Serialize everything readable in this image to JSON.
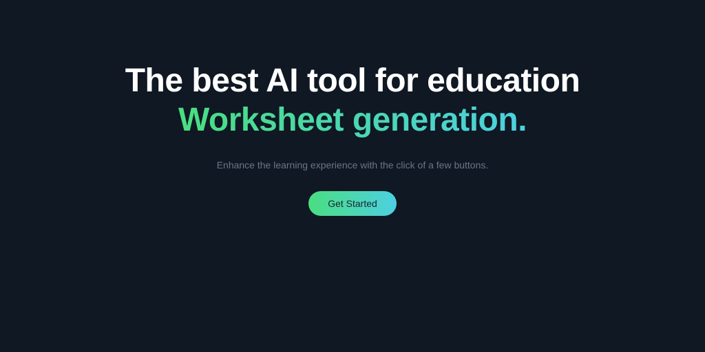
{
  "hero": {
    "headline_line1": "The best AI tool for education",
    "headline_line2": "Worksheet generation.",
    "subtitle": "Enhance the learning experience with the click of a few buttons.",
    "cta_label": "Get Started"
  }
}
